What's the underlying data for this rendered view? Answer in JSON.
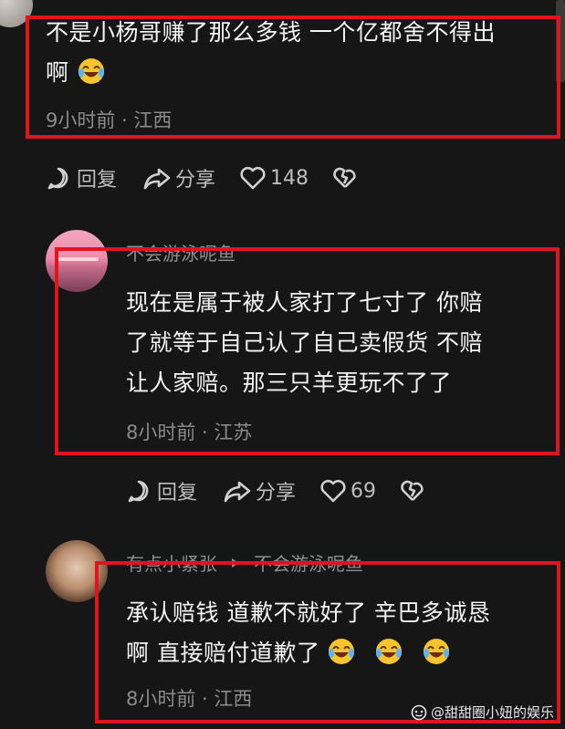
{
  "comments": [
    {
      "text_line1": "不是小杨哥赚了那么多钱 一个亿都舍不得出",
      "text_line2": "啊",
      "meta": "9小时前 · 江西",
      "reply_label": "回复",
      "share_label": "分享",
      "likes": "148"
    },
    {
      "username": "不会游泳呢鱼",
      "text_line1": "现在是属于被人家打了七寸了 你赔",
      "text_line2": "了就等于自己认了自己卖假货 不赔",
      "text_line3": "让人家赔。那三只羊更玩不了了",
      "meta": "8小时前 · 江苏",
      "reply_label": "回复",
      "share_label": "分享",
      "likes": "69"
    },
    {
      "username": "有点小紧张",
      "reply_to": "不会游泳呢鱼",
      "text_line1": "承认赔钱 道歉不就好了 辛巴多诚恳",
      "text_line2": "啊 直接赔付道歉了",
      "meta": "8小时前 · 江西"
    }
  ],
  "watermark": "@甜甜圈小妞的娱乐",
  "icons": {
    "reply": "comment-bubble-icon",
    "share": "share-arrow-icon",
    "like": "heart-icon",
    "dislike": "broken-heart-icon",
    "emoji": "laughing-tears-emoji",
    "reply_arrow": "triangle-right-icon"
  },
  "colors": {
    "background": "#161616",
    "highlight": "#e0141b",
    "text": "#f4f4f4",
    "muted": "#8b8b8b"
  }
}
